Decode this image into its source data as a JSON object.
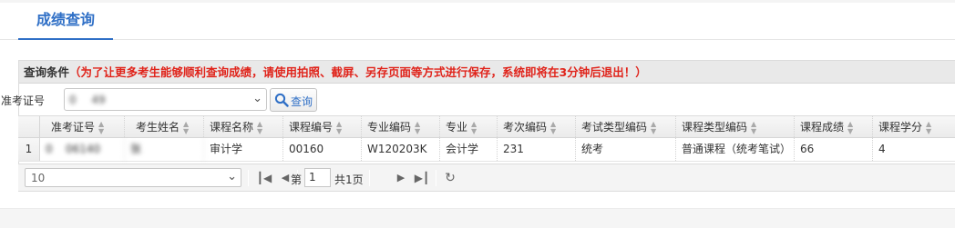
{
  "tab": {
    "label": "成绩查询"
  },
  "panel": {
    "label": "查询条件",
    "notice": "（为了让更多考生能够顺利查询成绩，请使用拍照、截屏、另存页面等方式进行保存，系统即将在3分钟后退出！）"
  },
  "query": {
    "field_label": "准考证号",
    "field_value": "0       49",
    "search_label": "查询"
  },
  "columns": [
    "准考证号",
    "考生姓名",
    "课程名称",
    "课程编号",
    "专业编码",
    "专业",
    "考次编码",
    "考试类型编码",
    "课程类型编码",
    "课程成绩",
    "课程学分"
  ],
  "rows": [
    {
      "num": "1",
      "exam_no": "0      06140",
      "name": "张   ",
      "course_name": "审计学",
      "course_code": "00160",
      "major_code": "W120203K",
      "major": "会计学",
      "session_code": "231",
      "exam_type": "统考",
      "course_type": "普通课程（统考笔试）",
      "score": "66",
      "credit": "4"
    }
  ],
  "pager": {
    "page_size": "10",
    "page_prefix": "第",
    "page_value": "1",
    "page_total": "共1页"
  },
  "icons": {
    "search": "magnifier-icon",
    "first": "first-page-icon",
    "prev": "prev-page-icon",
    "next": "next-page-icon",
    "last": "last-page-icon",
    "refresh": "refresh-icon"
  },
  "colors": {
    "accent": "#2f6fc6",
    "notice": "#e0241b"
  }
}
